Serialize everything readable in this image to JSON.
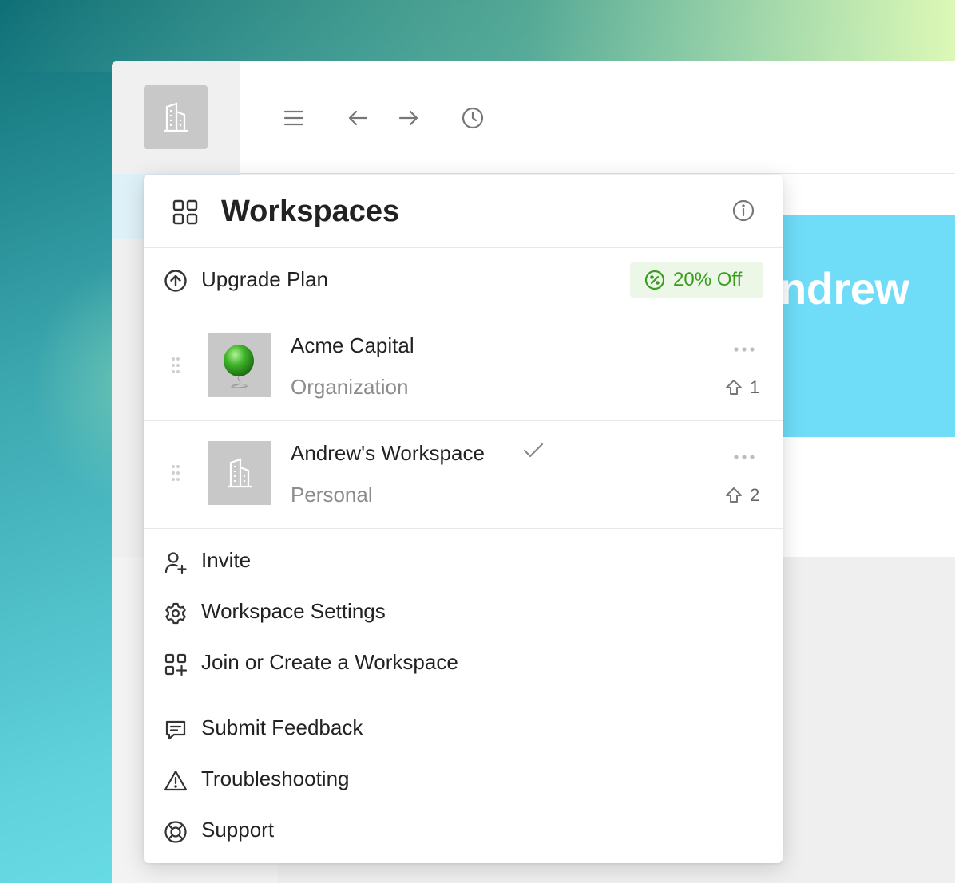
{
  "banner": {
    "text": "ndrew"
  },
  "toolbar": {
    "icons": [
      "menu-icon",
      "back-arrow-icon",
      "forward-arrow-icon",
      "history-icon"
    ]
  },
  "menu": {
    "title": "Workspaces",
    "upgrade": {
      "label": "Upgrade Plan",
      "badge": "20% Off",
      "badge_color": "#3a9d1f"
    },
    "workspaces": [
      {
        "name": "Acme Capital",
        "type": "Organization",
        "count": "1",
        "selected": false,
        "thumb": "green-balloon"
      },
      {
        "name": "Andrew's Workspace",
        "type": "Personal",
        "count": "2",
        "selected": true,
        "thumb": "building-icon"
      }
    ],
    "actions": [
      {
        "label": "Invite",
        "icon": "add-user-icon"
      },
      {
        "label": "Workspace Settings",
        "icon": "gear-icon"
      },
      {
        "label": "Join or Create a Workspace",
        "icon": "grid-plus-icon"
      }
    ],
    "help": [
      {
        "label": "Submit Feedback",
        "icon": "feedback-icon"
      },
      {
        "label": "Troubleshooting",
        "icon": "warning-icon"
      },
      {
        "label": "Support",
        "icon": "lifebuoy-icon"
      }
    ]
  }
}
